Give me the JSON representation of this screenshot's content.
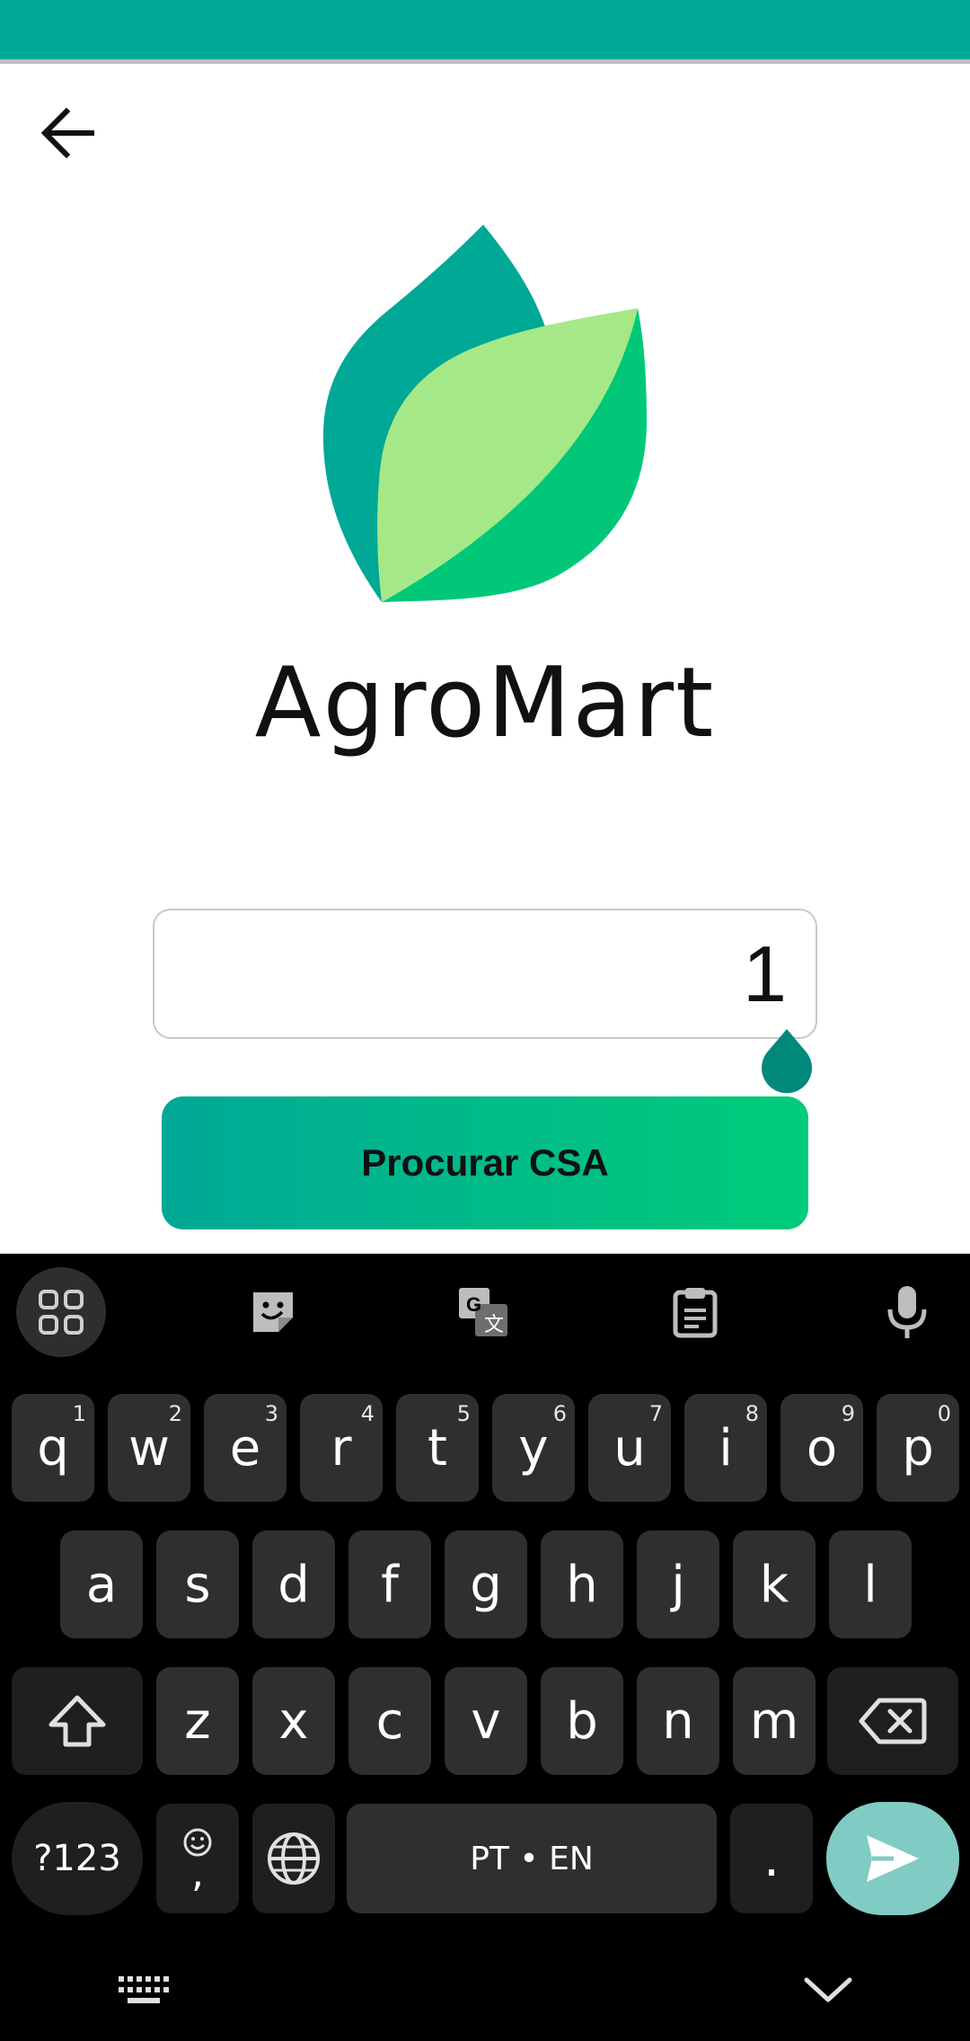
{
  "header": {
    "back_icon": "arrow-left-icon"
  },
  "app": {
    "name": "AgroMart",
    "logo_icon": "leaf-logo-icon"
  },
  "form": {
    "code_value": "1",
    "search_button_label": "Procurar CSA"
  },
  "colors": {
    "primary": "#00a896",
    "accent": "#00cc7a",
    "leaf_light": "#a5e887",
    "leaf_dark": "#00a896"
  },
  "keyboard": {
    "toolbar_icons": [
      "apps-grid-icon",
      "sticker-icon",
      "translate-icon",
      "clipboard-icon",
      "microphone-icon"
    ],
    "row1": [
      {
        "key": "q",
        "hint": "1"
      },
      {
        "key": "w",
        "hint": "2"
      },
      {
        "key": "e",
        "hint": "3"
      },
      {
        "key": "r",
        "hint": "4"
      },
      {
        "key": "t",
        "hint": "5"
      },
      {
        "key": "y",
        "hint": "6"
      },
      {
        "key": "u",
        "hint": "7"
      },
      {
        "key": "i",
        "hint": "8"
      },
      {
        "key": "o",
        "hint": "9"
      },
      {
        "key": "p",
        "hint": "0"
      }
    ],
    "row2": [
      "a",
      "s",
      "d",
      "f",
      "g",
      "h",
      "j",
      "k",
      "l"
    ],
    "row3": [
      "z",
      "x",
      "c",
      "v",
      "b",
      "n",
      "m"
    ],
    "symbols_label": "?123",
    "comma_label": ",",
    "space_label": "PT • EN",
    "period_label": ".",
    "nav_icons": [
      "keyboard-switch-icon",
      "hide-keyboard-icon"
    ]
  }
}
